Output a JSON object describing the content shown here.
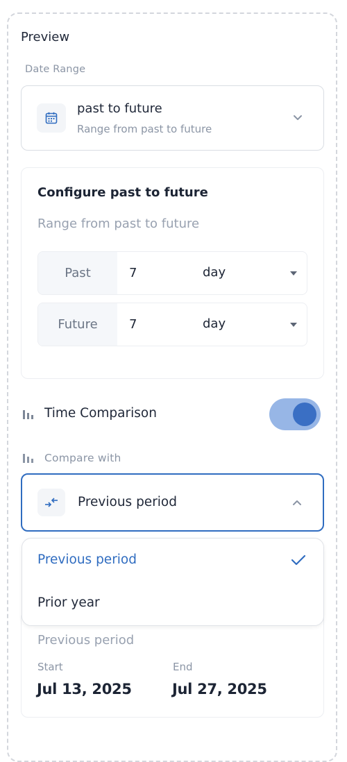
{
  "title": "Preview",
  "date_range": {
    "section_label": "Date Range",
    "selected_title": "past to future",
    "selected_subtitle": "Range from past to future",
    "icon": "calendar-icon"
  },
  "configure": {
    "title": "Configure past to future",
    "subtitle": "Range from past to future",
    "past": {
      "label": "Past",
      "value": "7",
      "unit": "day"
    },
    "future": {
      "label": "Future",
      "value": "7",
      "unit": "day"
    }
  },
  "time_comparison": {
    "label": "Time Comparison",
    "enabled": true,
    "toggle_color": "#3a6fc4"
  },
  "compare_with": {
    "label": "Compare with",
    "selected": "Previous period",
    "icon": "compare-arrows-icon",
    "options": [
      {
        "label": "Previous period",
        "selected": true
      },
      {
        "label": "Prior year",
        "selected": false
      }
    ]
  },
  "period_summary": {
    "label": "Previous period",
    "start_label": "Start",
    "start_value": "Jul 13, 2025",
    "end_label": "End",
    "end_value": "Jul 27, 2025"
  },
  "colors": {
    "accent": "#2f6cc0",
    "muted_text": "#8b95a5"
  }
}
